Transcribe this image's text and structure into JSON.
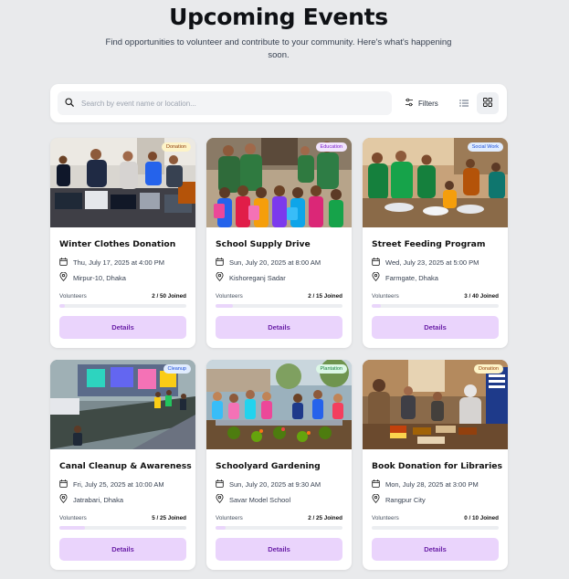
{
  "header": {
    "title": "Upcoming Events",
    "subtitle": "Find opportunities to volunteer and contribute to your community. Here's what's happening soon."
  },
  "toolbar": {
    "search_placeholder": "Search by event name or location...",
    "filters_label": "Filters",
    "view_list_icon": "list-icon",
    "view_grid_icon": "grid-icon",
    "active_view": "grid"
  },
  "colors": {
    "accent_button_bg": "#ead4fc",
    "accent_button_text": "#6b21a8",
    "page_bg": "#e9eaec"
  },
  "events": [
    {
      "title": "Winter Clothes Donation",
      "category": "Donation",
      "date": "Thu, July 17, 2025 at 4:00 PM",
      "location": "Mirpur-10, Dhaka",
      "volunteers_label": "Volunteers",
      "joined_text": "2 / 50 Joined",
      "joined": 2,
      "capacity": 50,
      "details_label": "Details",
      "badge_bg": "#fdf3c7",
      "badge_fg": "#92400e",
      "image": "clothes-donation-photo"
    },
    {
      "title": "School Supply Drive",
      "category": "Education",
      "date": "Sun, July 20, 2025 at 8:00 AM",
      "location": "Kishoreganj Sadar",
      "volunteers_label": "Volunteers",
      "joined_text": "2 / 15 Joined",
      "joined": 2,
      "capacity": 15,
      "details_label": "Details",
      "badge_bg": "#f1e4fd",
      "badge_fg": "#7e22ce",
      "image": "school-supply-photo"
    },
    {
      "title": "Street Feeding Program",
      "category": "Social Work",
      "date": "Wed, July 23, 2025 at 5:00 PM",
      "location": "Farmgate, Dhaka",
      "volunteers_label": "Volunteers",
      "joined_text": "3 / 40 Joined",
      "joined": 3,
      "capacity": 40,
      "details_label": "Details",
      "badge_bg": "#e0ecfe",
      "badge_fg": "#1d4ed8",
      "image": "street-feeding-photo"
    },
    {
      "title": "Canal Cleanup & Awareness",
      "category": "Cleanup",
      "date": "Fri, July 25, 2025 at 10:00 AM",
      "location": "Jatrabari, Dhaka",
      "volunteers_label": "Volunteers",
      "joined_text": "5 / 25 Joined",
      "joined": 5,
      "capacity": 25,
      "details_label": "Details",
      "badge_bg": "#e0ecfe",
      "badge_fg": "#1d4ed8",
      "image": "canal-cleanup-photo"
    },
    {
      "title": "Schoolyard Gardening",
      "category": "Plantation",
      "date": "Sun, July 20, 2025 at 9:30 AM",
      "location": "Savar Model School",
      "volunteers_label": "Volunteers",
      "joined_text": "2 / 25 Joined",
      "joined": 2,
      "capacity": 25,
      "details_label": "Details",
      "badge_bg": "#dcf7e6",
      "badge_fg": "#15803d",
      "image": "gardening-photo"
    },
    {
      "title": "Book Donation for Libraries",
      "category": "Donation",
      "date": "Mon, July 28, 2025 at 3:00 PM",
      "location": "Rangpur City",
      "volunteers_label": "Volunteers",
      "joined_text": "0 / 10 Joined",
      "joined": 0,
      "capacity": 10,
      "details_label": "Details",
      "badge_bg": "#fdf3c7",
      "badge_fg": "#92400e",
      "image": "book-donation-photo"
    }
  ]
}
